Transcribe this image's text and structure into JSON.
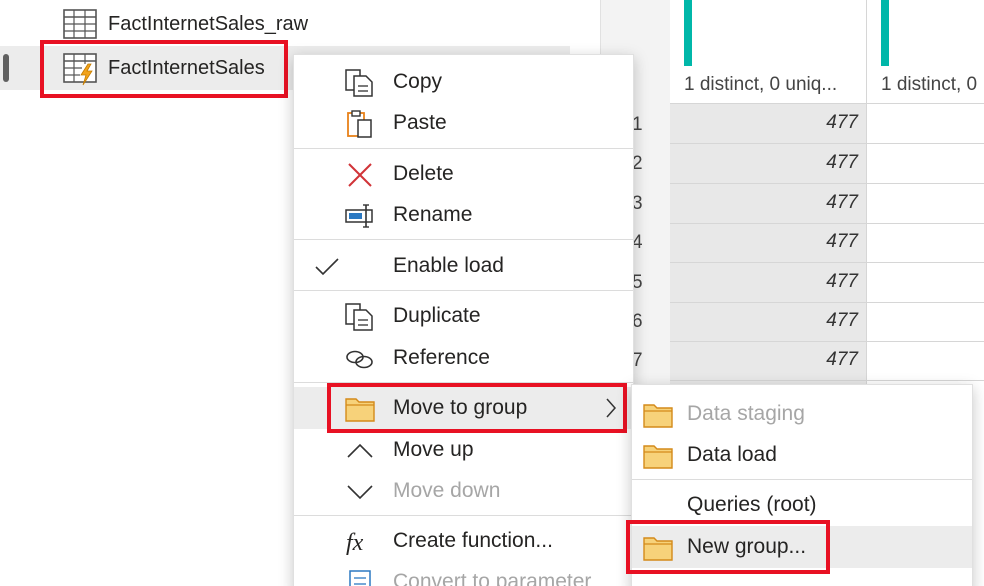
{
  "queries": {
    "items": [
      {
        "label": "FactInternetSales_raw",
        "icon": "table-icon"
      },
      {
        "label": "FactInternetSales",
        "icon": "table-lightning-icon",
        "selected": true
      }
    ]
  },
  "grid": {
    "col1_stats": "1 distinct, 0 uniq...",
    "col2_stats": "1 distinct, 0",
    "row_numbers": [
      "1",
      "2",
      "3",
      "4",
      "5",
      "6",
      "7"
    ],
    "values": [
      "477",
      "477",
      "477",
      "477",
      "477",
      "477",
      "477"
    ]
  },
  "context_menu": {
    "copy": "Copy",
    "paste": "Paste",
    "delete": "Delete",
    "rename": "Rename",
    "enable_load": "Enable load",
    "duplicate": "Duplicate",
    "reference": "Reference",
    "move_to_group": "Move to group",
    "move_up": "Move up",
    "move_down": "Move down",
    "create_function": "Create function...",
    "convert_to_parameter": "Convert to parameter"
  },
  "submenu": {
    "data_staging": "Data staging",
    "data_load": "Data load",
    "queries_root": "Queries (root)",
    "new_group": "New group..."
  },
  "colors": {
    "highlight_red": "#e81123",
    "teal": "#00b7a9",
    "folder_orange": "#f7d27a",
    "delete_red": "#d13438"
  }
}
